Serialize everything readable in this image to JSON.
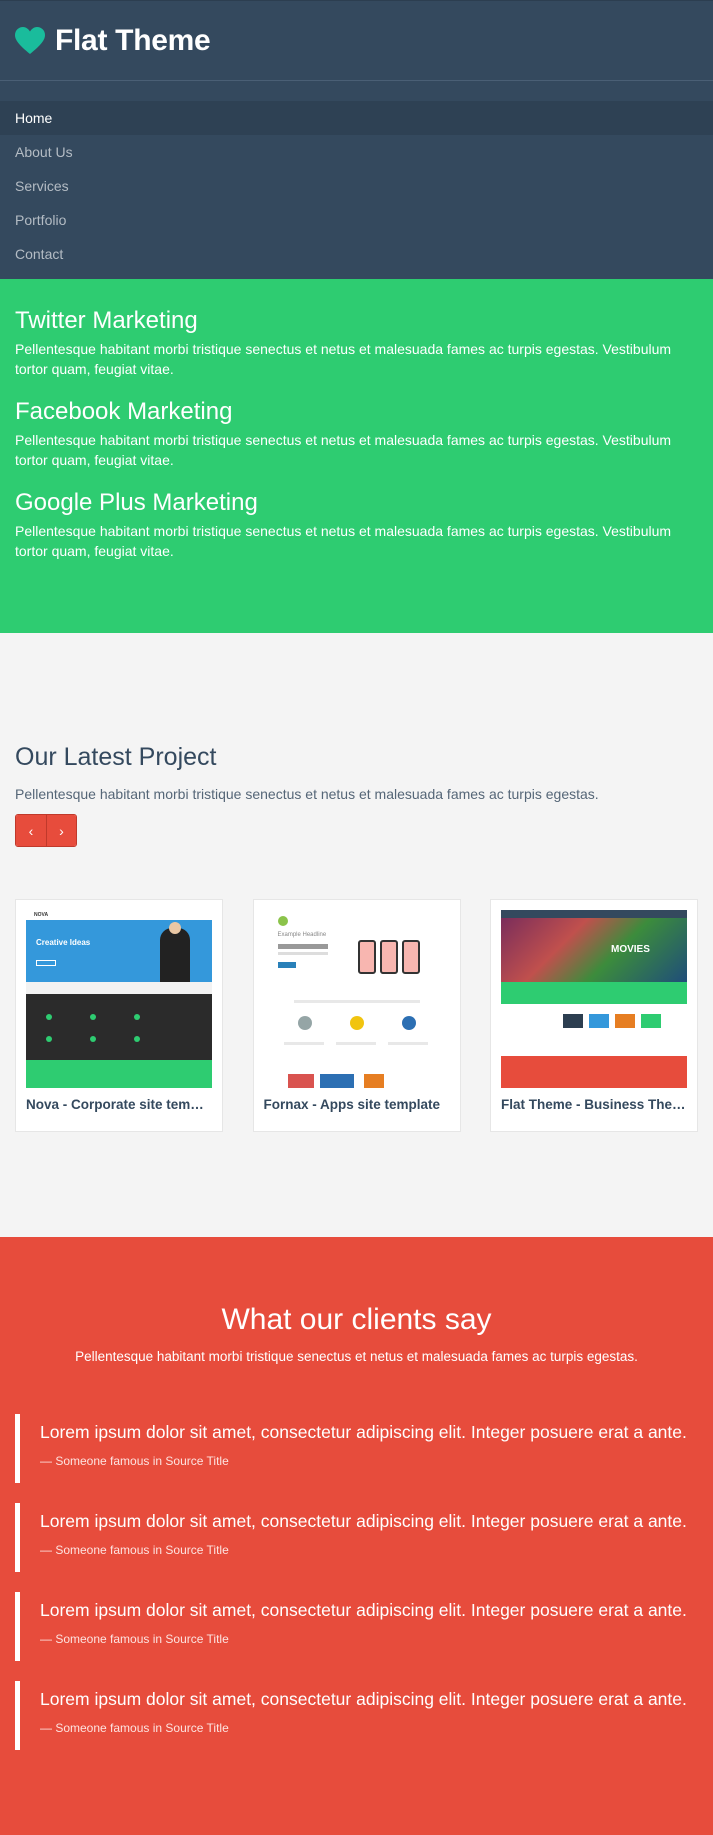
{
  "header": {
    "brand": "Flat Theme",
    "brand_icon": "heart-icon",
    "brand_color": "#1abc9c"
  },
  "nav": {
    "items": [
      {
        "label": "Home",
        "active": true
      },
      {
        "label": "About Us"
      },
      {
        "label": "Services"
      },
      {
        "label": "Portfolio"
      },
      {
        "label": "Contact"
      }
    ]
  },
  "services": {
    "items": [
      {
        "title": "Twitter Marketing",
        "text": "Pellentesque habitant morbi tristique senectus et netus et malesuada fames ac turpis egestas. Vestibulum tortor quam, feugiat vitae."
      },
      {
        "title": "Facebook Marketing",
        "text": "Pellentesque habitant morbi tristique senectus et netus et malesuada fames ac turpis egestas. Vestibulum tortor quam, feugiat vitae."
      },
      {
        "title": "Google Plus Marketing",
        "text": "Pellentesque habitant morbi tristique senectus et netus et malesuada fames ac turpis egestas. Vestibulum tortor quam, feugiat vitae."
      }
    ]
  },
  "projects": {
    "title": "Our Latest Project",
    "lead": "Pellentesque habitant morbi tristique senectus et netus et malesuada fames ac turpis egestas.",
    "prev_icon": "chevron-left-icon",
    "next_icon": "chevron-right-icon",
    "prev_glyph": "‹",
    "next_glyph": "›",
    "cards": [
      {
        "title": "Nova - Corporate site template",
        "thumb_heading": "Creative Ideas",
        "thumb_brand": "NOVA"
      },
      {
        "title": "Fornax - Apps site template",
        "thumb_heading": "Example Headline"
      },
      {
        "title": "Flat Theme - Business Theme",
        "thumb_banner": "MOVIES"
      }
    ]
  },
  "testimonials": {
    "title": "What our clients say",
    "lead": "Pellentesque habitant morbi tristique senectus et netus et malesuada fames ac turpis egestas.",
    "quotes": [
      {
        "text": "Lorem ipsum dolor sit amet, consectetur adipiscing elit. Integer posuere erat a ante.",
        "source": "— Someone famous in Source Title"
      },
      {
        "text": "Lorem ipsum dolor sit amet, consectetur adipiscing elit. Integer posuere erat a ante.",
        "source": "— Someone famous in Source Title"
      },
      {
        "text": "Lorem ipsum dolor sit amet, consectetur adipiscing elit. Integer posuere erat a ante.",
        "source": "— Someone famous in Source Title"
      },
      {
        "text": "Lorem ipsum dolor sit amet, consectetur adipiscing elit. Integer posuere erat a ante.",
        "source": "— Someone famous in Source Title"
      }
    ]
  },
  "colors": {
    "navy": "#34495e",
    "green": "#2ecc71",
    "red": "#e74c3c",
    "light": "#f4f4f4"
  }
}
